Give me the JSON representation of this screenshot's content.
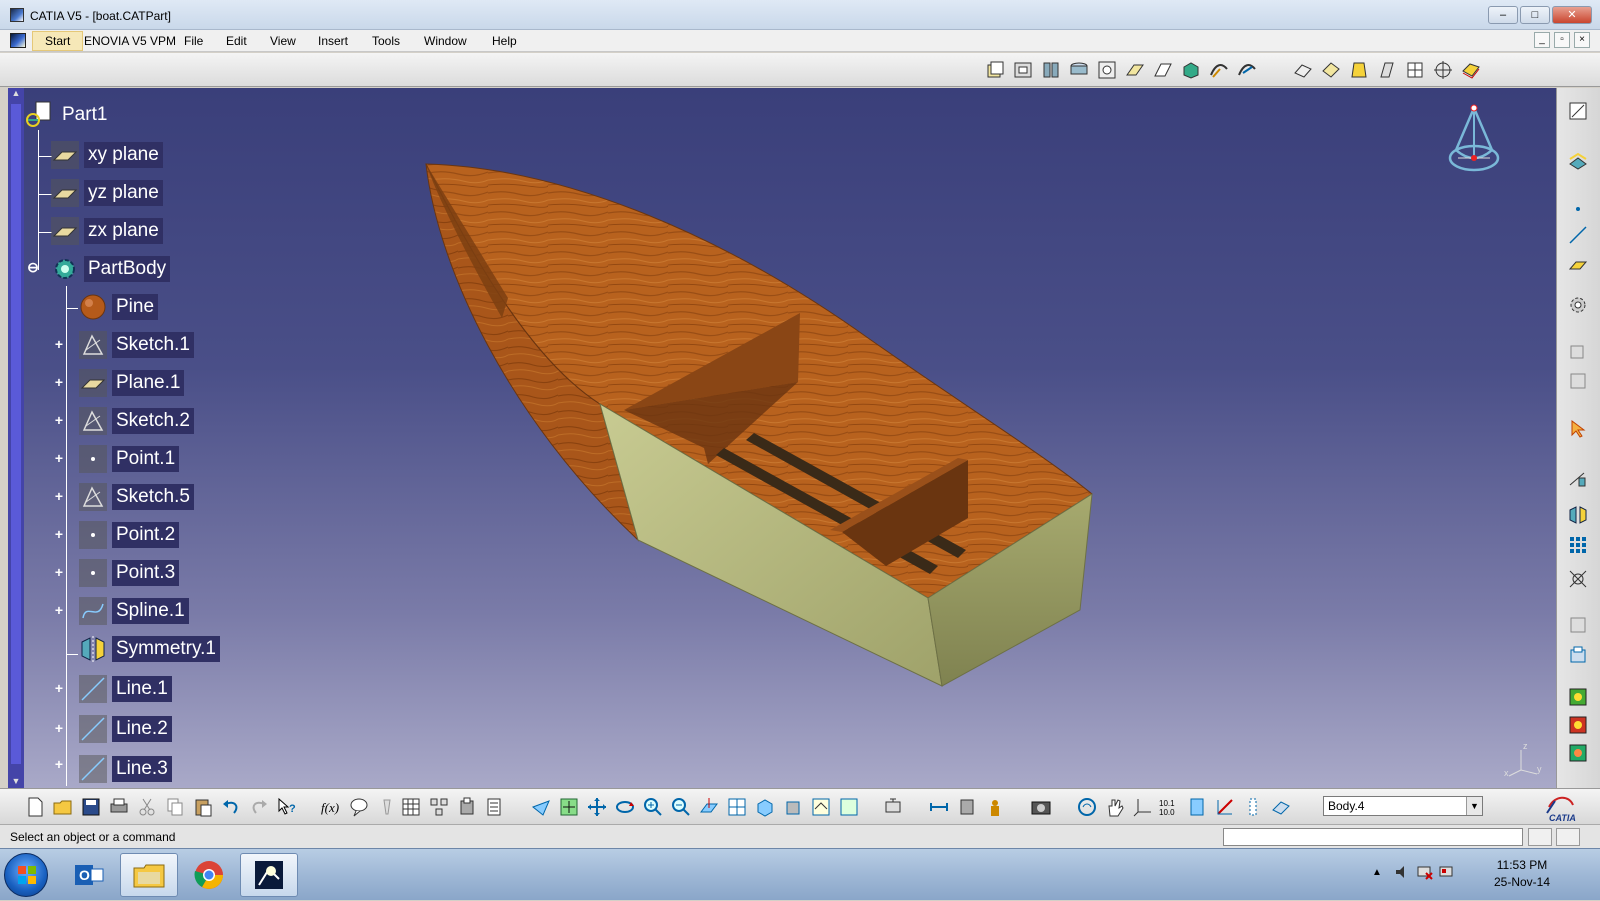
{
  "window": {
    "title": "CATIA V5 - [boat.CATPart]",
    "buttons": {
      "minimize": "–",
      "maximize": "□",
      "close": "✕"
    }
  },
  "menu": {
    "items": [
      "Start",
      "ENOVIA V5 VPM",
      "File",
      "Edit",
      "View",
      "Insert",
      "Tools",
      "Window",
      "Help"
    ]
  },
  "tree": {
    "items": [
      {
        "label": "Part1",
        "icon": "part-icon"
      },
      {
        "label": "xy plane",
        "icon": "plane-icon"
      },
      {
        "label": "yz plane",
        "icon": "plane-icon"
      },
      {
        "label": "zx plane",
        "icon": "plane-icon"
      },
      {
        "label": "PartBody",
        "icon": "partbody-gear-icon"
      },
      {
        "label": "Pine",
        "icon": "material-sphere-icon"
      },
      {
        "label": "Sketch.1",
        "icon": "sketch-icon"
      },
      {
        "label": "Plane.1",
        "icon": "plane-icon"
      },
      {
        "label": "Sketch.2",
        "icon": "sketch-icon"
      },
      {
        "label": "Point.1",
        "icon": "point-icon"
      },
      {
        "label": "Sketch.5",
        "icon": "sketch-icon"
      },
      {
        "label": "Point.2",
        "icon": "point-icon"
      },
      {
        "label": "Point.3",
        "icon": "point-icon"
      },
      {
        "label": "Spline.1",
        "icon": "spline-icon"
      },
      {
        "label": "Symmetry.1",
        "icon": "symmetry-icon"
      },
      {
        "label": "Line.1",
        "icon": "line-icon"
      },
      {
        "label": "Line.2",
        "icon": "line-icon"
      },
      {
        "label": "Line.3",
        "icon": "line-icon"
      }
    ]
  },
  "bottom_toolbar": {
    "current_body": "Body.4",
    "logo": "CATIA"
  },
  "status": {
    "message": "Select an object or a command"
  },
  "taskbar": {
    "time": "11:53 PM",
    "date": "25-Nov-14"
  },
  "colors": {
    "viewport_top": "#3a3f7a",
    "viewport_bottom": "#a9a9c8",
    "wood": "#b8621e",
    "hull_side": "#b9bc84"
  }
}
